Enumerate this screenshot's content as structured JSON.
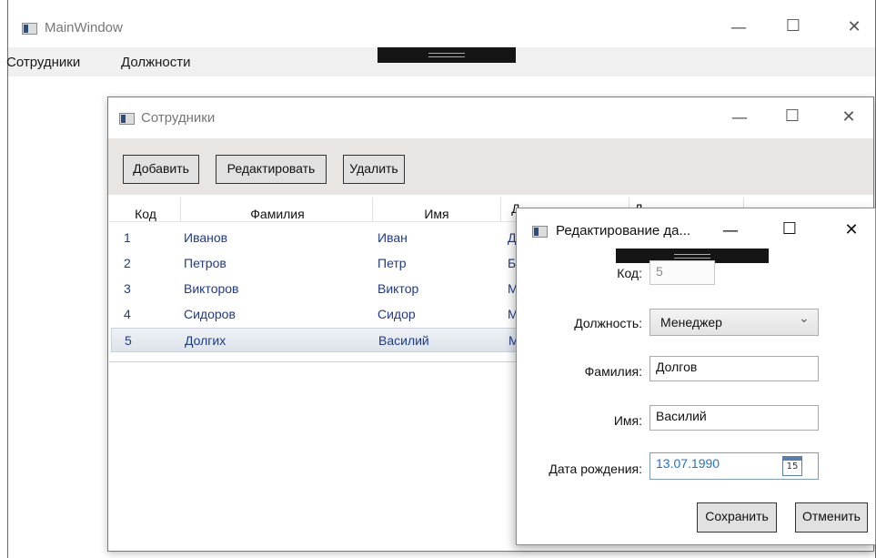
{
  "main_window": {
    "title": "MainWindow",
    "menu": [
      "Сотрудники",
      "Должности"
    ]
  },
  "employees_window": {
    "title": "Сотрудники",
    "toolbar": {
      "add": "Добавить",
      "edit": "Редактировать",
      "delete": "Удалить"
    },
    "columns": [
      "Код",
      "Фамилия",
      "Имя",
      "Д",
      "Д"
    ],
    "rows": [
      {
        "id": "1",
        "last": "Иванов",
        "first": "Иван",
        "pos": "Д"
      },
      {
        "id": "2",
        "last": "Петров",
        "first": "Петр",
        "pos": "Б"
      },
      {
        "id": "3",
        "last": "Викторов",
        "first": "Виктор",
        "pos": "М"
      },
      {
        "id": "4",
        "last": "Сидоров",
        "first": "Сидор",
        "pos": "М"
      },
      {
        "id": "5",
        "last": "Долгих",
        "first": "Василий",
        "pos": "М"
      }
    ]
  },
  "edit_dialog": {
    "title": "Редактирование да...",
    "labels": {
      "code": "Код:",
      "position": "Должность:",
      "last": "Фамилия:",
      "first": "Имя:",
      "dob": "Дата рождения:"
    },
    "values": {
      "code": "5",
      "position": "Менеджер",
      "last": "Долгов",
      "first": "Василий",
      "dob": "13.07.1990"
    },
    "calendar_day": "15",
    "buttons": {
      "save": "Сохранить",
      "cancel": "Отменить"
    }
  },
  "glyphs": {
    "minimize": "—",
    "maximize": "☐",
    "close": "✕",
    "chevron": "⌄"
  }
}
